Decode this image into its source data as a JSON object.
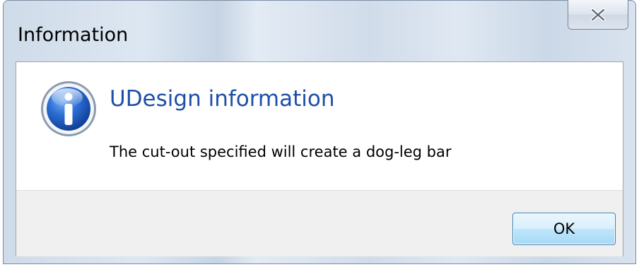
{
  "window": {
    "title": "Information",
    "close_icon": "close-icon"
  },
  "dialog": {
    "icon": "information-icon",
    "heading": "UDesign information",
    "message": "The cut-out specified will create a dog-leg bar",
    "heading_color": "#1e4fa8"
  },
  "footer": {
    "ok_label": "OK"
  }
}
